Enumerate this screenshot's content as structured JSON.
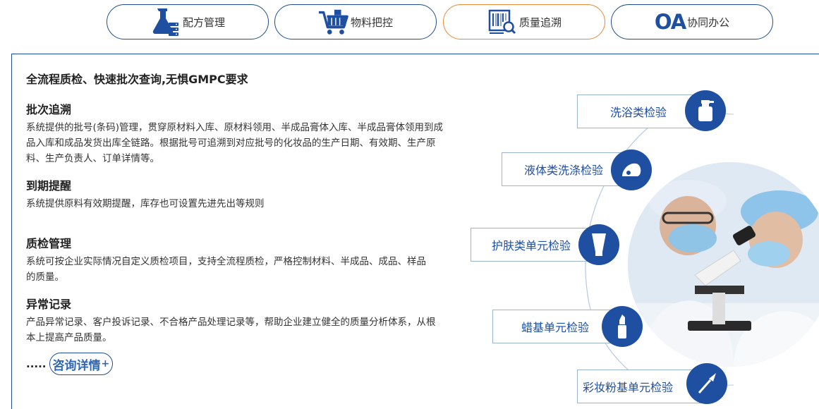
{
  "tabs": [
    {
      "label": "配方管理",
      "icon": "flask-icon"
    },
    {
      "label": "物料把控",
      "icon": "cart-icon"
    },
    {
      "label": "质量追溯",
      "icon": "barcode-search-icon"
    },
    {
      "label": "协同办公",
      "prefix": "OA",
      "icon": "oa-icon"
    }
  ],
  "main": {
    "headline": "全流程质检、快速批次查询,无惧GMPC要求",
    "sections": [
      {
        "title": "批次追溯",
        "body": "系统提供的批号(条码)管理，贯穿原材料入库、原材料领用、半成品膏体入库、半成品膏体领用到成品入库和成品发货出库全链路。根据批号可追溯到对应批号的化妆品的生产日期、有效期、生产原料、生产负责人、订单详情等。"
      },
      {
        "title": "到期提醒",
        "body": "系统提供原料有效期提醒，库存也可设置先进先出等规则"
      },
      {
        "title": "质检管理",
        "body": "系统可按企业实际情况自定义质检项目，支持全流程质检，严格控制材料、半成品、成品、样品的质量。"
      },
      {
        "title": "异常记录",
        "body": "产品异常记录、客户投诉记录、不合格产品处理记录等，帮助企业建立健全的质量分析体系，从根本上提高产品质量。"
      }
    ],
    "more_dots": ".....",
    "consult_label": "咨询详情",
    "consult_plus": "+"
  },
  "graphic": {
    "items": [
      {
        "label": "洗浴类检验",
        "icon": "spray-bottle-icon"
      },
      {
        "label": "液体类洗涤检验",
        "icon": "drop-icon"
      },
      {
        "label": "护肤类单元检验",
        "icon": "cream-tube-icon"
      },
      {
        "label": "蜡基单元检验",
        "icon": "lipstick-icon"
      },
      {
        "label": "彩妆粉基单元检验",
        "icon": "brush-icon"
      }
    ],
    "accent": "#1e4fa0"
  }
}
